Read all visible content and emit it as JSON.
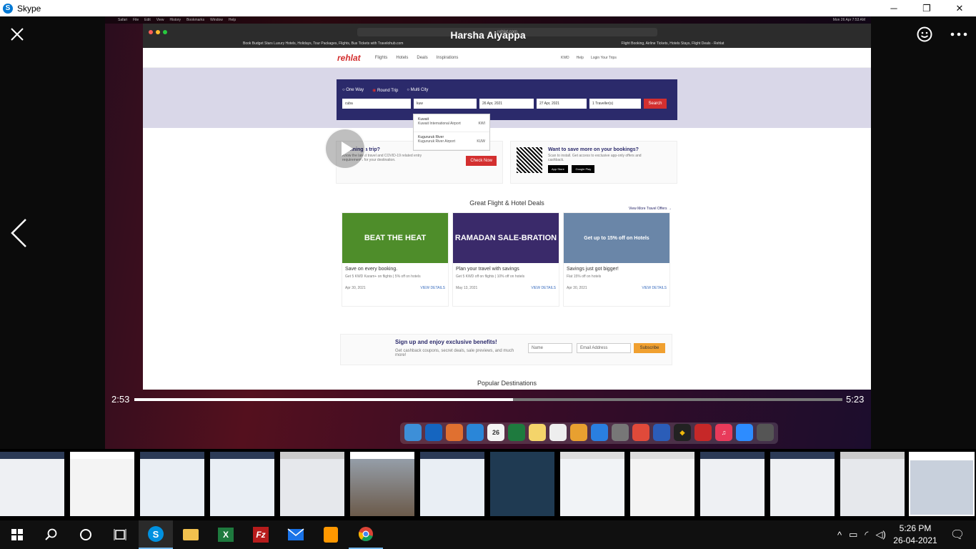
{
  "window": {
    "title": "Skype",
    "app_icon": "S"
  },
  "call": {
    "caller_name": "Harsha Aiyappa"
  },
  "player": {
    "current_time": "2:53",
    "total_time": "5:23",
    "progress": 0.535
  },
  "browser": {
    "url": "rehlat.com",
    "tab_left": "Book Budget Stars Luxury Hotels, Holidays, Tour Packages, Flights, Bus Tickets with Travelohub.com",
    "tab_right": "Flight Booking, Airline Tickets, Hotels Stays, Flight Deals - Rehlat"
  },
  "site": {
    "logo": "rehlat",
    "nav": [
      "Flights",
      "Hotels",
      "Deals",
      "Inspirations"
    ],
    "header_right": [
      "KWD",
      "Help",
      "Login Your Trips"
    ],
    "trip_types": [
      "One Way",
      "Round Trip",
      "Multi City"
    ],
    "from_value": "cuba",
    "to_value": "kuw",
    "depart": "26 Apr, 2021",
    "return": "27 Apr, 2021",
    "travellers": "1 Traveller(s)",
    "search_label": "Search",
    "dropdown": [
      {
        "city": "Kuwait",
        "airport": "Kuwait International Airport",
        "code": "KWI"
      },
      {
        "city": "Kugururuk River",
        "airport": "Kugururuk River Airport",
        "code": "KUW"
      }
    ],
    "planning": {
      "title": "Planning a trip?",
      "text": "Know the latest travel and COVID-19 related entry requirements for your destination.",
      "button": "Check Now"
    },
    "app": {
      "title": "Want to save more on your bookings?",
      "text": "Scan to install. Get access to exclusive app-only offers and cashback.",
      "store1": "App Store",
      "store2": "Google Play"
    },
    "deals_title": "Great Flight & Hotel Deals",
    "view_more": "View More Travel Offers →",
    "deals": [
      {
        "banner": "BEAT THE HEAT",
        "title": "Save on every booking.",
        "desc": "Get 5 KWD Karam+ on flights | 5% off on hotels",
        "date": "Apr 30, 2021",
        "link": "VIEW DETAILS",
        "color": "#4e8d2a"
      },
      {
        "banner": "RAMADAN SALE-BRATION",
        "title": "Plan your travel with savings",
        "desc": "Get 5 KWD off on flights | 10% off on hotels",
        "date": "May 13, 2021",
        "link": "VIEW DETAILS",
        "color": "#3a2a6a"
      },
      {
        "banner": "Get up to 15% off on Hotels",
        "title": "Savings just got bigger!",
        "desc": "Flat 15% off on hotels",
        "date": "Apr 30, 2021",
        "link": "VIEW DETAILS",
        "color": "#6a86a8"
      }
    ],
    "signup": {
      "title": "Sign up and enjoy exclusive benefits!",
      "text": "Get cashback coupons, secret deals, sale previews, and much more!",
      "name_placeholder": "Name",
      "email_placeholder": "Email Address",
      "button": "Subscribe"
    },
    "popular": "Popular Destinations"
  },
  "mac_menu": [
    "Safari",
    "File",
    "Edit",
    "View",
    "History",
    "Bookmarks",
    "Window",
    "Help"
  ],
  "mac_clock": "Mon 26 Apr 7:53 AM",
  "dock_icons": [
    "finder",
    "outlook",
    "launchpad",
    "safari",
    "calendar",
    "excel",
    "notes",
    "reminders",
    "photos",
    "appstore",
    "settings",
    "chrome",
    "word",
    "binance",
    "acrobat",
    "music",
    "zoom",
    "trash"
  ],
  "calendar_day": "26",
  "taskbar": {
    "time": "5:26 PM",
    "date": "26-04-2021",
    "apps": [
      "start",
      "search",
      "cortana",
      "task-view",
      "skype",
      "file-explorer",
      "excel",
      "filezilla",
      "mail",
      "sublime",
      "chrome"
    ]
  }
}
